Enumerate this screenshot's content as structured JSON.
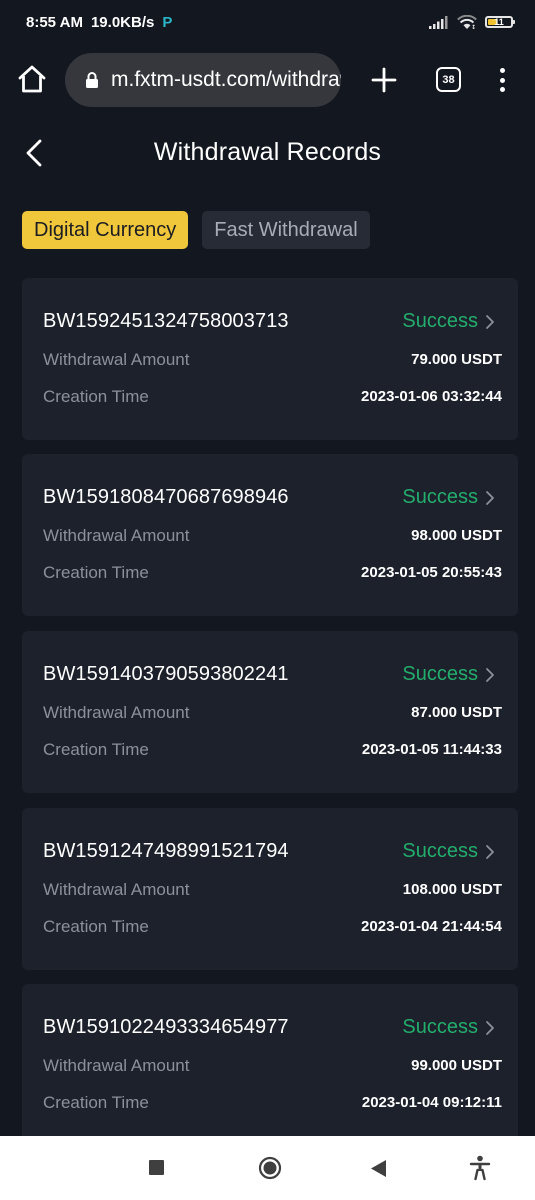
{
  "status_bar": {
    "time": "8:55 AM",
    "speed": "19.0KB/s",
    "app_icon": "P",
    "battery": "11"
  },
  "browser": {
    "url": "m.fxtm-usdt.com/withdrawal",
    "tab_count": "38"
  },
  "header": {
    "title": "Withdrawal Records"
  },
  "tabs": [
    {
      "label": "Digital Currency",
      "active": true
    },
    {
      "label": "Fast Withdrawal",
      "active": false
    }
  ],
  "labels": {
    "amount": "Withdrawal Amount",
    "time": "Creation Time"
  },
  "records": [
    {
      "id": "BW1592451324758003713",
      "status": "Success",
      "amount": "79.000 USDT",
      "time": "2023-01-06 03:32:44"
    },
    {
      "id": "BW1591808470687698946",
      "status": "Success",
      "amount": "98.000 USDT",
      "time": "2023-01-05 20:55:43"
    },
    {
      "id": "BW1591403790593802241",
      "status": "Success",
      "amount": "87.000 USDT",
      "time": "2023-01-05 11:44:33"
    },
    {
      "id": "BW1591247498991521794",
      "status": "Success",
      "amount": "108.000 USDT",
      "time": "2023-01-04 21:44:54"
    },
    {
      "id": "BW1591022493334654977",
      "status": "Success",
      "amount": "99.000 USDT",
      "time": "2023-01-04 09:12:11"
    }
  ],
  "colors": {
    "background": "#131720",
    "card": "#1d212b",
    "accent": "#f0c63b",
    "success": "#23ad6c"
  }
}
